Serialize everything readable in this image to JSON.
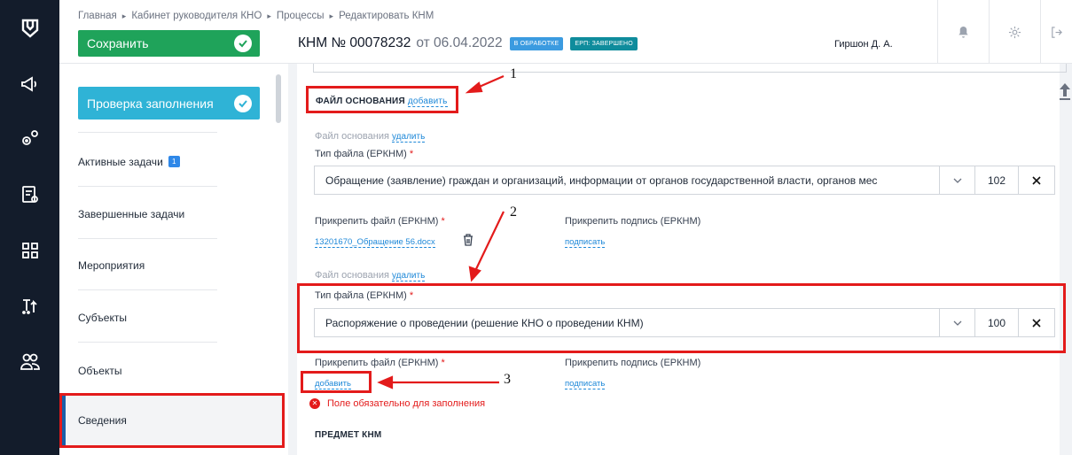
{
  "breadcrumb": [
    "Главная",
    "Кабинет руководителя КНО",
    "Процессы",
    "Редактировать КНМ"
  ],
  "toolbar": {
    "save_label": "Сохранить",
    "check_label": "Проверка заполнения"
  },
  "knm": {
    "number": "КНМ № 00078232",
    "date": "от 06.04.2022",
    "status_badge": "В ОБРАБОТКЕ",
    "erp_badge": "ЕРП: ЗАВЕРШЕНО"
  },
  "user": {
    "name": "Гиршон Д. А."
  },
  "nav": {
    "active_tasks": "Активные задачи",
    "active_tasks_count": "1",
    "completed_tasks": "Завершенные задачи",
    "events": "Мероприятия",
    "subjects": "Субъекты",
    "objects": "Объекты",
    "info": "Сведения"
  },
  "section": {
    "title": "ФАЙЛ ОСНОВАНИЯ",
    "add_link": "добавить"
  },
  "file1": {
    "header": "Файл основания",
    "remove_link": "удалить",
    "type_label": "Тип файла (ЕРКНМ)",
    "type_value": "Обращение (заявление) граждан и организаций, информации от органов государственной власти, органов мес",
    "type_code": "102",
    "attach_label": "Прикрепить файл (ЕРКНМ)",
    "attached_file": "13201670_Обращение 56.docx",
    "sign_label": "Прикрепить подпись (ЕРКНМ)",
    "sign_link": "подписать"
  },
  "file2": {
    "header": "Файл основания",
    "remove_link": "удалить",
    "type_label": "Тип файла (ЕРКНМ)",
    "type_value": "Распоряжение о проведении (решение КНО о проведении КНМ)",
    "type_code": "100",
    "attach_label": "Прикрепить файл (ЕРКНМ)",
    "add_link": "добавить",
    "sign_label": "Прикрепить подпись (ЕРКНМ)",
    "sign_link": "подписать",
    "error": "Поле обязательно для заполнения"
  },
  "subject_section": {
    "title": "ПРЕДМЕТ КНМ"
  },
  "required_mark": "*",
  "annotations": [
    "1",
    "2",
    "3"
  ],
  "colors": {
    "save": "#1fa35a",
    "check": "#2fb3d6",
    "rail": "#131c2b",
    "highlight": "#e31b1b",
    "link": "#1e88d8"
  }
}
